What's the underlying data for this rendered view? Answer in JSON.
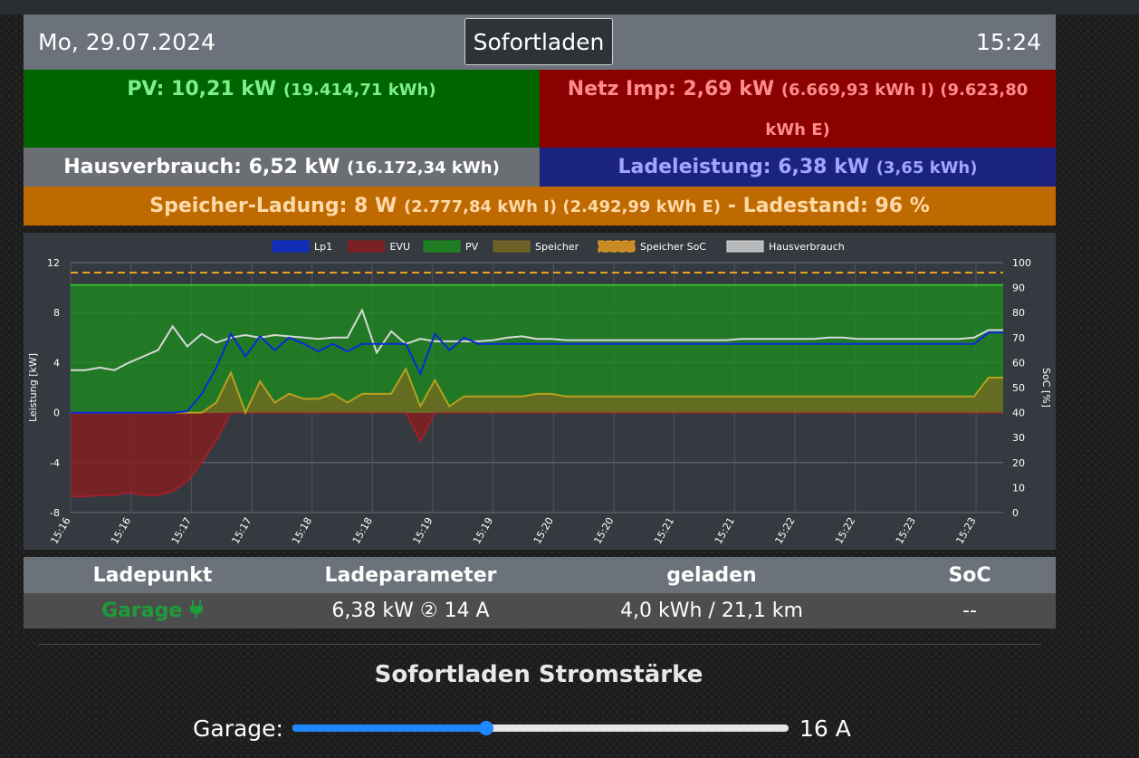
{
  "header": {
    "date": "Mo, 29.07.2024",
    "mode": "Sofortladen",
    "time": "15:24"
  },
  "pv": {
    "main": "PV: 10,21 kW",
    "sub": "(19.414,71 kWh)"
  },
  "netz": {
    "main": "Netz Imp: 2,69 kW",
    "sub": "(6.669,93 kWh I) (9.623,80 kWh E)"
  },
  "haus": {
    "main": "Hausverbrauch: 6,52 kW",
    "sub": "(16.172,34 kWh)"
  },
  "lade": {
    "main": "Ladeleistung: 6,38 kW",
    "sub": "(3,65 kWh)"
  },
  "speicher": {
    "main": "Speicher-Ladung: 8 W",
    "sub": "(2.777,84 kWh I) (2.492,99 kWh E)",
    "tail": "- Ladestand: 96 %"
  },
  "chart_data": {
    "type": "area",
    "legend_position": "top",
    "ylabel": "Leistung [kW]",
    "y2label": "SoC [%]",
    "ylim": [
      -8,
      12
    ],
    "y2lim": [
      0,
      100
    ],
    "yticks": [
      12,
      8,
      4,
      0,
      -4,
      -8
    ],
    "y2ticks": [
      100,
      90,
      80,
      70,
      60,
      50,
      40,
      30,
      20,
      10,
      0
    ],
    "xticks": [
      "15:16",
      "15:16",
      "15:17",
      "15:17",
      "15:18",
      "15:18",
      "15:19",
      "15:19",
      "15:20",
      "15:20",
      "15:21",
      "15:21",
      "15:22",
      "15:22",
      "15:23",
      "15:23"
    ],
    "x_index": [
      0,
      1,
      2,
      3,
      4,
      5,
      6,
      7,
      8,
      9,
      10,
      11,
      12,
      13,
      14,
      15,
      16,
      17,
      18,
      19,
      20,
      21,
      22,
      23,
      24,
      25,
      26,
      27,
      28,
      29,
      30,
      31,
      32,
      33,
      34,
      35,
      36,
      37,
      38,
      39,
      40,
      41,
      42,
      43,
      44,
      45,
      46,
      47,
      48,
      49,
      50,
      51,
      52,
      53,
      54,
      55,
      56,
      57,
      58,
      59,
      60,
      61,
      62,
      63,
      64
    ],
    "series": [
      {
        "name": "Lp1",
        "color": "#0a2bd6",
        "axis": "left",
        "fill": false,
        "values": [
          0,
          0,
          0,
          0,
          0,
          0,
          0,
          0,
          0.1,
          1.5,
          3.6,
          6.3,
          4.5,
          6.1,
          5.0,
          6.0,
          5.5,
          4.9,
          5.5,
          4.9,
          5.5,
          5.5,
          5.5,
          5.5,
          3.1,
          6.3,
          5.0,
          6.0,
          5.5,
          5.5,
          5.5,
          5.5,
          5.5,
          5.5,
          5.5,
          5.5,
          5.5,
          5.5,
          5.5,
          5.5,
          5.5,
          5.5,
          5.5,
          5.5,
          5.5,
          5.5,
          5.5,
          5.5,
          5.5,
          5.5,
          5.5,
          5.5,
          5.5,
          5.5,
          5.5,
          5.5,
          5.5,
          5.5,
          5.5,
          5.5,
          5.5,
          5.5,
          5.5,
          6.4,
          6.4
        ]
      },
      {
        "name": "EVU",
        "color": "#8b1c1c",
        "axis": "left",
        "fill": true,
        "values": [
          -6.7,
          -6.7,
          -6.6,
          -6.6,
          -6.4,
          -6.6,
          -6.6,
          -6.3,
          -5.5,
          -4.0,
          -2.2,
          0,
          0,
          0,
          0,
          0,
          0,
          0,
          0,
          0,
          0,
          0,
          0,
          0,
          -2.3,
          0,
          0,
          0,
          0,
          0,
          0,
          0,
          0,
          0,
          0,
          0,
          0,
          0,
          0,
          0,
          0,
          0,
          0,
          0,
          0,
          0,
          0,
          0,
          0,
          0,
          0,
          0,
          0,
          0,
          0,
          0,
          0,
          0,
          0,
          0,
          0,
          0,
          0,
          0,
          0
        ]
      },
      {
        "name": "PV",
        "color": "#1c8f1c",
        "axis": "left",
        "fill": true,
        "values": [
          10.2,
          10.2,
          10.2,
          10.2,
          10.2,
          10.2,
          10.2,
          10.2,
          10.2,
          10.2,
          10.2,
          10.2,
          10.2,
          10.2,
          10.2,
          10.2,
          10.2,
          10.2,
          10.2,
          10.2,
          10.2,
          10.2,
          10.2,
          10.2,
          10.2,
          10.2,
          10.2,
          10.2,
          10.2,
          10.2,
          10.2,
          10.2,
          10.2,
          10.2,
          10.2,
          10.2,
          10.2,
          10.2,
          10.2,
          10.2,
          10.2,
          10.2,
          10.2,
          10.2,
          10.2,
          10.2,
          10.2,
          10.2,
          10.2,
          10.2,
          10.2,
          10.2,
          10.2,
          10.2,
          10.2,
          10.2,
          10.2,
          10.2,
          10.2,
          10.2,
          10.2,
          10.2,
          10.2,
          10.2,
          10.2
        ]
      },
      {
        "name": "Speicher",
        "color": "#7a6a20",
        "axis": "left",
        "fill": true,
        "values": [
          0,
          0,
          0,
          0,
          0,
          0,
          0,
          0,
          0,
          0,
          0.8,
          3.2,
          0,
          2.5,
          0.8,
          1.5,
          1.1,
          1.1,
          1.5,
          0.8,
          1.5,
          1.5,
          1.5,
          3.5,
          0.5,
          2.6,
          0.5,
          1.3,
          1.3,
          1.3,
          1.3,
          1.3,
          1.5,
          1.5,
          1.3,
          1.3,
          1.3,
          1.3,
          1.3,
          1.3,
          1.3,
          1.3,
          1.3,
          1.3,
          1.3,
          1.3,
          1.3,
          1.3,
          1.3,
          1.3,
          1.3,
          1.3,
          1.3,
          1.3,
          1.3,
          1.3,
          1.3,
          1.3,
          1.3,
          1.3,
          1.3,
          1.3,
          1.3,
          2.8,
          2.8
        ]
      },
      {
        "name": "Speicher SoC",
        "color": "#f0a020",
        "axis": "right",
        "fill": false,
        "dashed": true,
        "values": [
          96,
          96,
          96,
          96,
          96,
          96,
          96,
          96,
          96,
          96,
          96,
          96,
          96,
          96,
          96,
          96,
          96,
          96,
          96,
          96,
          96,
          96,
          96,
          96,
          96,
          96,
          96,
          96,
          96,
          96,
          96,
          96,
          96,
          96,
          96,
          96,
          96,
          96,
          96,
          96,
          96,
          96,
          96,
          96,
          96,
          96,
          96,
          96,
          96,
          96,
          96,
          96,
          96,
          96,
          96,
          96,
          96,
          96,
          96,
          96,
          96,
          96,
          96,
          96,
          96
        ]
      },
      {
        "name": "Hausverbrauch",
        "color": "#d8d8d8",
        "axis": "left",
        "fill": false,
        "values": [
          3.4,
          3.4,
          3.6,
          3.4,
          4.0,
          4.5,
          5.0,
          6.9,
          5.3,
          6.3,
          5.6,
          6.0,
          6.2,
          6.0,
          6.2,
          6.1,
          6.0,
          5.9,
          6.0,
          6.0,
          8.2,
          4.8,
          6.5,
          5.5,
          5.9,
          5.7,
          5.7,
          5.7,
          5.7,
          5.8,
          6.0,
          6.1,
          5.9,
          5.9,
          5.8,
          5.8,
          5.8,
          5.8,
          5.8,
          5.8,
          5.8,
          5.8,
          5.8,
          5.8,
          5.8,
          5.8,
          5.9,
          5.9,
          5.9,
          5.9,
          5.9,
          5.9,
          6.0,
          6.0,
          5.9,
          5.9,
          5.9,
          5.9,
          5.9,
          5.9,
          5.9,
          5.9,
          6.0,
          6.6,
          6.6
        ]
      }
    ]
  },
  "table": {
    "headers": [
      "Ladepunkt",
      "Ladeparameter",
      "geladen",
      "SoC"
    ],
    "row": {
      "name": "Garage",
      "plug_icon": "plug-icon",
      "params": "6,38 kW ② 14 A",
      "charged": "4,0 kWh / 21,1 km",
      "soc": "--"
    }
  },
  "section": {
    "title": "Sofortladen Stromstärke"
  },
  "slider": {
    "label": "Garage:",
    "value_text": "16 A",
    "fraction": 0.39
  }
}
